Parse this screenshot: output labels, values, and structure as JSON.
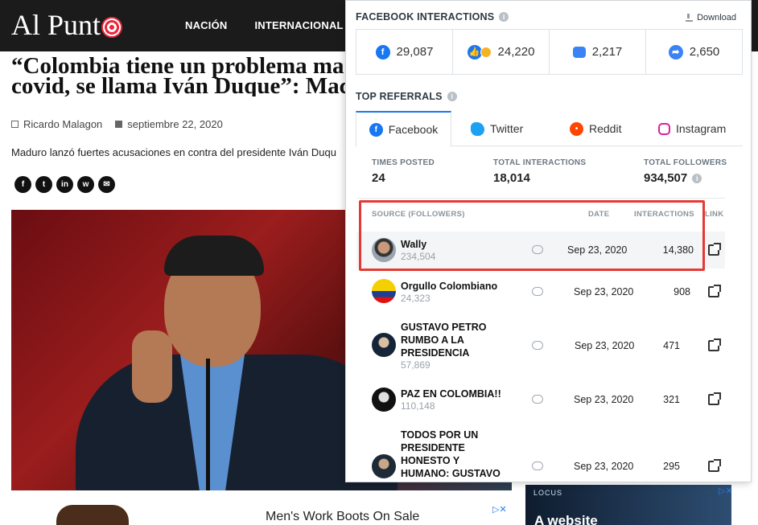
{
  "site": {
    "logo": "Al Punt",
    "nav": [
      "NACIÓN",
      "INTERNACIONAL"
    ]
  },
  "article": {
    "title_line1": "“Colombia tiene un problema ma",
    "title_line2": "covid, se llama Iván Duque”: Mac",
    "author": "Ricardo Malagon",
    "date": "septiembre 22, 2020",
    "excerpt": "Maduro lanzó fuertes acusaciones en contra del presidente Iván Duqu",
    "share_icons": [
      "facebook-icon",
      "twitter-icon",
      "linkedin-icon",
      "whatsapp-icon",
      "email-icon"
    ]
  },
  "ads": {
    "left_text": "Men's Work Boots On Sale",
    "right_brand": "LOCUS",
    "right_text": "A website"
  },
  "panel": {
    "facebook_interactions_title": "FACEBOOK INTERACTIONS",
    "download_label": "Download",
    "interactions": {
      "total": "29,087",
      "reactions": "24,220",
      "comments": "2,217",
      "shares": "2,650"
    },
    "top_referrals_title": "TOP REFERRALS",
    "tabs": [
      "Facebook",
      "Twitter",
      "Reddit",
      "Instagram"
    ],
    "active_tab": "Facebook",
    "stats": {
      "times_posted_label": "TIMES POSTED",
      "times_posted": "24",
      "total_interactions_label": "TOTAL INTERACTIONS",
      "total_interactions": "18,014",
      "total_followers_label": "TOTAL FOLLOWERS",
      "total_followers": "934,507"
    },
    "columns": {
      "source": "SOURCE (FOLLOWERS)",
      "date": "DATE",
      "interactions": "INTERACTIONS",
      "link": "LINK"
    },
    "rows": [
      {
        "name": "Wally",
        "followers": "234,504",
        "date": "Sep 23, 2020",
        "interactions": "14,380"
      },
      {
        "name": "Orgullo Colombiano",
        "followers": "24,323",
        "date": "Sep 23, 2020",
        "interactions": "908"
      },
      {
        "name_l1": "GUSTAVO PETRO",
        "name_l2": "RUMBO A LA",
        "name_l3": "PRESIDENCIA",
        "followers": "57,869",
        "date": "Sep 23, 2020",
        "interactions": "471"
      },
      {
        "name": "PAZ EN COLOMBIA!!",
        "followers": "110,148",
        "date": "Sep 23, 2020",
        "interactions": "321"
      },
      {
        "name_l1": "TODOS POR UN",
        "name_l2": "PRESIDENTE",
        "name_l3": "HONESTO Y",
        "name_l4": "HUMANO: GUSTAVO",
        "date": "Sep 23, 2020",
        "interactions": "295"
      }
    ],
    "colors": {
      "facebook_blue": "#1877f2",
      "twitter_blue": "#1da1f2",
      "reddit_orange": "#ff4500",
      "instagram_pink": "#d6249f",
      "highlight_red": "#e53935"
    }
  }
}
